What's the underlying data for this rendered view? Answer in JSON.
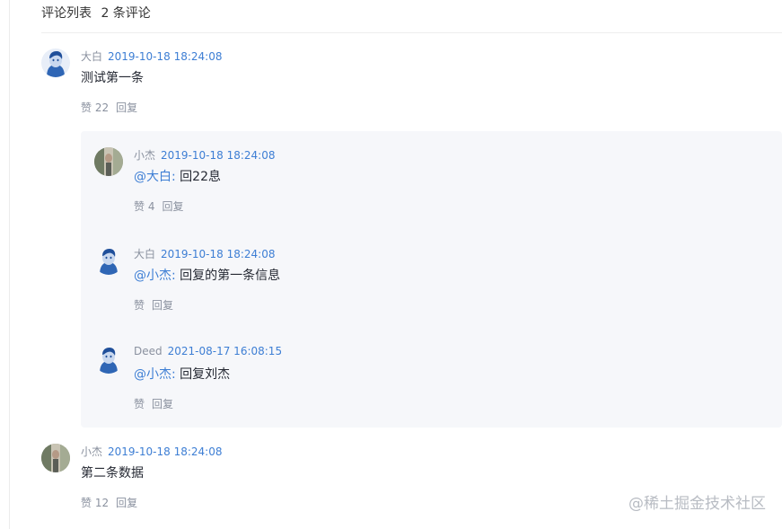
{
  "header": {
    "title": "评论列表",
    "count_text": "2 条评论"
  },
  "comments": [
    {
      "author": "大白",
      "time": "2019-10-18 18:24:08",
      "mention": "",
      "text": "测试第一条",
      "like_label": "赞 22",
      "reply_label": "回复",
      "avatar": "blue-face-avatar",
      "replies": [
        {
          "author": "小杰",
          "time": "2019-10-18 18:24:08",
          "mention": "@大白:",
          "text": "回22息",
          "like_label": "赞 4",
          "reply_label": "回复",
          "avatar": "photo-avatar"
        },
        {
          "author": "大白",
          "time": "2019-10-18 18:24:08",
          "mention": "@小杰:",
          "text": "回复的第一条信息",
          "like_label": "赞",
          "reply_label": "回复",
          "avatar": "blue-face-avatar"
        },
        {
          "author": "Deed",
          "time": "2021-08-17 16:08:15",
          "mention": "@小杰:",
          "text": "回复刘杰",
          "like_label": "赞",
          "reply_label": "回复",
          "avatar": "blue-face-avatar"
        }
      ]
    },
    {
      "author": "小杰",
      "time": "2019-10-18 18:24:08",
      "mention": "",
      "text": "第二条数据",
      "like_label": "赞 12",
      "reply_label": "回复",
      "avatar": "photo-avatar",
      "replies": []
    }
  ],
  "watermark": "@稀土掘金技术社区",
  "colors": {
    "link": "#3d7ed4",
    "muted": "#8a919f",
    "panel_bg": "#f6f7fa"
  }
}
